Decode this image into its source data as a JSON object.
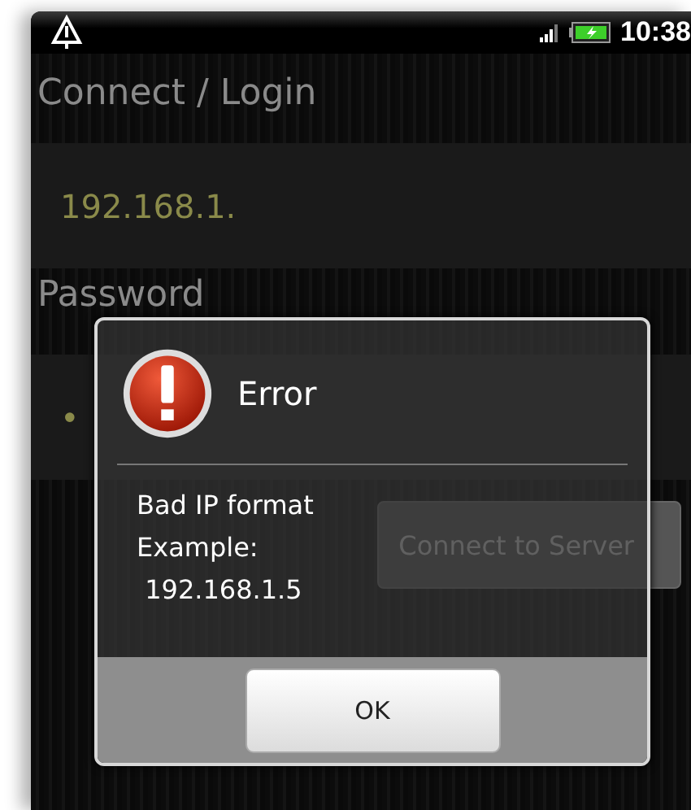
{
  "status_bar": {
    "time": "10:38"
  },
  "title": "Connect / Login",
  "ip_field": {
    "value": "192.168.1."
  },
  "password_label": "Password",
  "password_field": {
    "value": "•"
  },
  "connect_button": {
    "label": "Connect to Server"
  },
  "dialog": {
    "title": "Error",
    "message_lines": [
      "Bad IP format",
      "Example:",
      " 192.168.1.5"
    ],
    "buttons": [
      "OK"
    ]
  }
}
